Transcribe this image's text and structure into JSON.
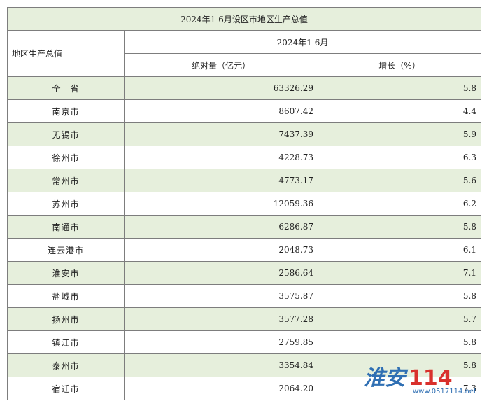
{
  "table": {
    "title": "2024年1-6月设区市地区生产总值",
    "row_header": "地区生产总值",
    "period": "2024年1-6月",
    "col_abs": "绝对量（亿元）",
    "col_growth": "增长（%）",
    "rows": [
      {
        "region": "全　省",
        "abs": "63326.29",
        "growth": "5.8"
      },
      {
        "region": "南京市",
        "abs": "8607.42",
        "growth": "4.4"
      },
      {
        "region": "无锡市",
        "abs": "7437.39",
        "growth": "5.9"
      },
      {
        "region": "徐州市",
        "abs": "4228.73",
        "growth": "6.3"
      },
      {
        "region": "常州市",
        "abs": "4773.17",
        "growth": "5.6"
      },
      {
        "region": "苏州市",
        "abs": "12059.36",
        "growth": "6.2"
      },
      {
        "region": "南通市",
        "abs": "6286.87",
        "growth": "5.8"
      },
      {
        "region": "连云港市",
        "abs": "2048.73",
        "growth": "6.1"
      },
      {
        "region": "淮安市",
        "abs": "2586.64",
        "growth": "7.1"
      },
      {
        "region": "盐城市",
        "abs": "3575.87",
        "growth": "5.8"
      },
      {
        "region": "扬州市",
        "abs": "3577.28",
        "growth": "5.7"
      },
      {
        "region": "镇江市",
        "abs": "2759.85",
        "growth": "5.8"
      },
      {
        "region": "泰州市",
        "abs": "3354.84",
        "growth": "5.8"
      },
      {
        "region": "宿迁市",
        "abs": "2064.20",
        "growth": "7.3"
      }
    ]
  },
  "watermark": {
    "name": "淮安",
    "number": "114",
    "url": "www.0517114.net"
  },
  "colors": {
    "row_green": "#e6efdc",
    "border": "#7d7d7d"
  }
}
